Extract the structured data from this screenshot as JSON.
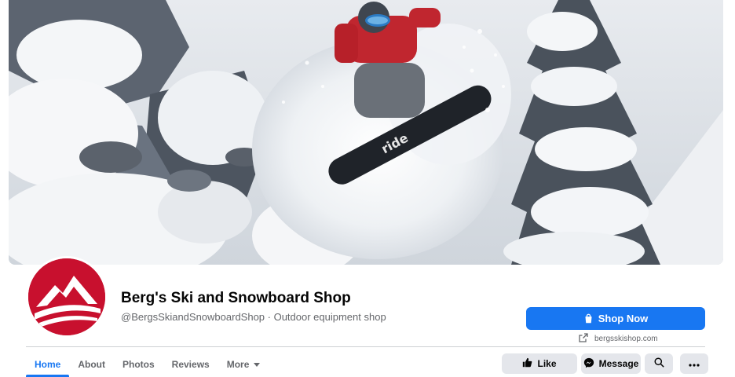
{
  "page": {
    "name": "Berg's Ski and Snowboard Shop",
    "subtitle": "@BergsSkiandSnowboardShop · Outdoor equipment shop",
    "brand_color": "#c8102e"
  },
  "cta": {
    "label": "Shop Now",
    "icon": "shopping-bag-icon",
    "color": "#1877f2"
  },
  "website": {
    "label": "bergsskishop.com",
    "icon": "external-link-icon"
  },
  "tabs": [
    {
      "label": "Home",
      "active": true
    },
    {
      "label": "About"
    },
    {
      "label": "Photos"
    },
    {
      "label": "Reviews"
    },
    {
      "label": "More",
      "icon": "caret-down-icon"
    }
  ],
  "actions": {
    "like": {
      "label": "Like",
      "icon": "thumbs-up-icon"
    },
    "message": {
      "label": "Message",
      "icon": "messenger-icon"
    },
    "search": {
      "icon": "search-icon"
    },
    "more": {
      "icon": "more-dots-icon"
    }
  },
  "cover": {
    "description_icon": "cover-photo",
    "board_text": "ride"
  }
}
